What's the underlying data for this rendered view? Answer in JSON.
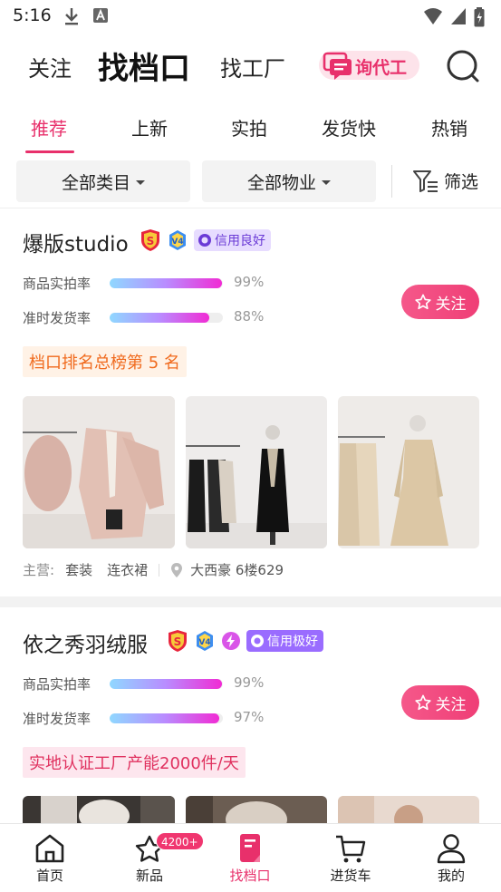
{
  "status_bar": {
    "time": "5:16"
  },
  "top_nav": {
    "items": [
      "关注",
      "找档口",
      "找工厂"
    ],
    "active": "找档口",
    "inquiry_label": "询代工"
  },
  "tabs": {
    "items": [
      "推荐",
      "上新",
      "实拍",
      "发货快",
      "热销"
    ],
    "active": "推荐"
  },
  "filters": {
    "category": "全部类目",
    "property": "全部物业",
    "filter_label": "筛选"
  },
  "stores": [
    {
      "name": "爆版studio",
      "credit": "信用良好",
      "has_lightning": false,
      "metrics": [
        {
          "label": "商品实拍率",
          "value": "99%",
          "fraction": 0.99
        },
        {
          "label": "准时发货率",
          "value": "88%",
          "fraction": 0.88
        }
      ],
      "follow_label": "关注",
      "tag": "档口排名总榜第 5 名",
      "main_label": "主营:",
      "categories": [
        "套装",
        "连衣裙"
      ],
      "location": "大西豪 6楼629"
    },
    {
      "name": "依之秀羽绒服",
      "credit": "信用极好",
      "has_lightning": true,
      "metrics": [
        {
          "label": "商品实拍率",
          "value": "99%",
          "fraction": 0.99
        },
        {
          "label": "准时发货率",
          "value": "97%",
          "fraction": 0.97
        }
      ],
      "follow_label": "关注",
      "tag": "实地认证工厂产能2000件/天"
    }
  ],
  "bottom_nav": {
    "items": [
      {
        "label": "首页",
        "icon": "home-icon"
      },
      {
        "label": "新品",
        "icon": "new-products-icon",
        "badge": "4200+"
      },
      {
        "label": "找档口",
        "icon": "find-stall-icon"
      },
      {
        "label": "进货车",
        "icon": "cart-icon"
      },
      {
        "label": "我的",
        "icon": "profile-icon"
      }
    ],
    "active": "找档口"
  },
  "colors": {
    "accent": "#e8306b",
    "credit_purple": "#9a6cff",
    "rank_orange": "#f06a1d"
  }
}
